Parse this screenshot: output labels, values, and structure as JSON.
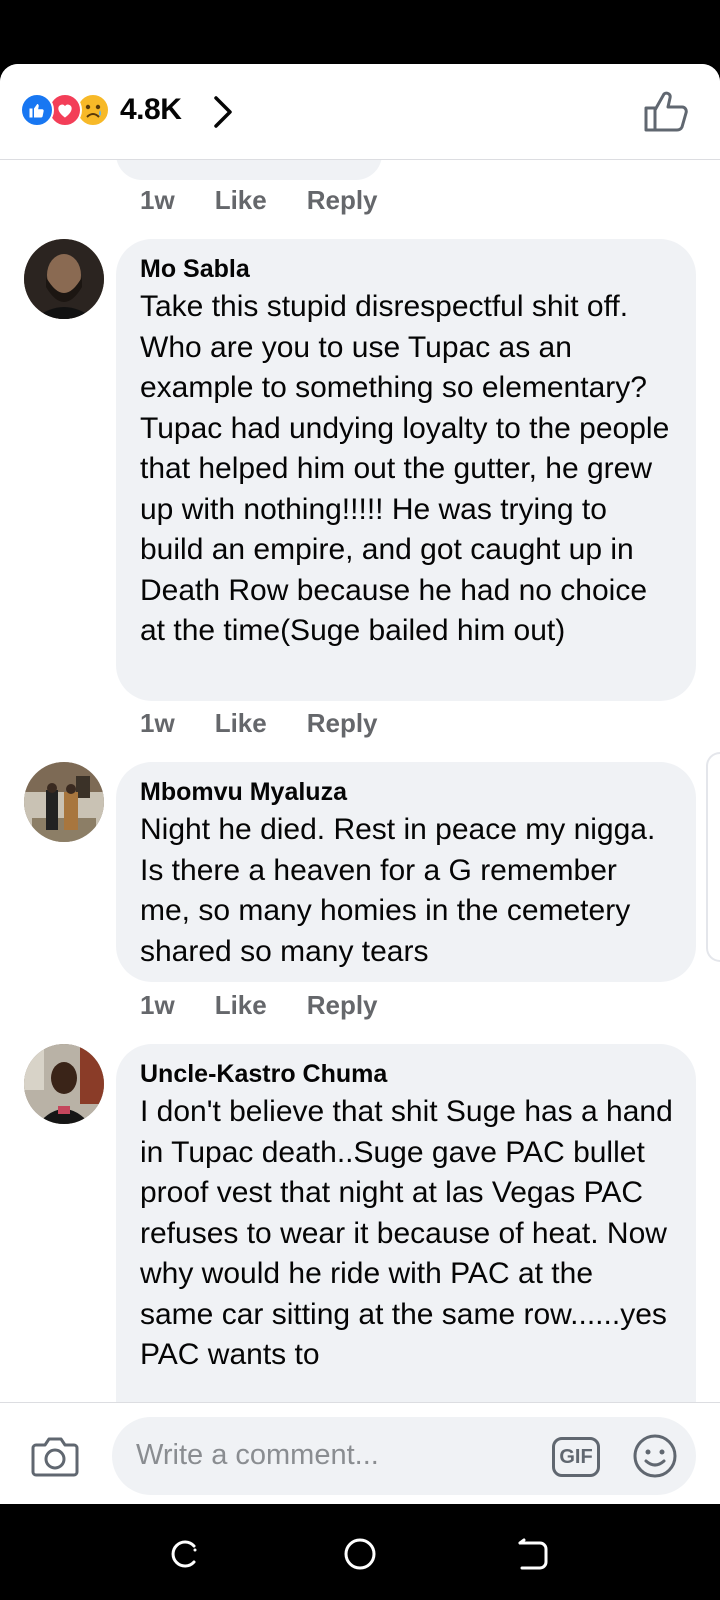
{
  "header": {
    "reaction_count": "4.8K",
    "reactions": [
      "like-icon",
      "love-icon",
      "sad-icon"
    ]
  },
  "previous_comment": {
    "partial_text": "~ ~ ~ ~ ~ ~ ~ ~ ~",
    "time": "1w",
    "like_label": "Like",
    "reply_label": "Reply"
  },
  "comments": [
    {
      "name": "Mo Sabla",
      "text": "Take this stupid disrespectful shit off. Who are you to use Tupac as an example to something so elementary? Tupac had undying loyalty to the people that helped him out the gutter, he grew up with nothing!!!!! He was trying to build an empire, and got caught up in Death Row because he had no choice at the time(Suge bailed him out)",
      "time": "1w",
      "like_label": "Like",
      "reply_label": "Reply"
    },
    {
      "name": "Mbomvu Myaluza",
      "text": "Night he died. Rest in peace my nigga. Is there a heaven for a G remember me, so many homies in the cemetery shared so many tears",
      "time": "1w",
      "like_label": "Like",
      "reply_label": "Reply"
    },
    {
      "name": "Uncle-Kastro Chuma",
      "text": "I don't believe that shit Suge has a hand in Tupac death..Suge gave PAC bullet proof vest that night at las Vegas PAC refuses to wear it because of heat. Now why would he ride with PAC at the same car sitting at the same row......yes PAC wants to"
    }
  ],
  "composer": {
    "placeholder": "Write a comment...",
    "gif_label": "GIF"
  },
  "colors": {
    "accent": "#1877f2",
    "bubble": "#f0f2f5",
    "meta": "#65676b"
  }
}
